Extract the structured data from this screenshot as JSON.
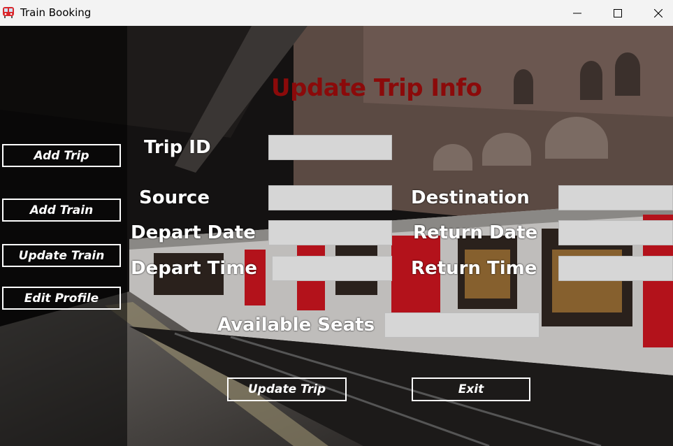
{
  "window": {
    "title": "Train Booking",
    "app_icon": "train-icon",
    "controls": [
      "minimize-icon",
      "maximize-icon",
      "close-icon"
    ]
  },
  "heading": "Update Trip Info",
  "colors": {
    "heading": "#8b0a0a",
    "field_bg": "#d6d6d6",
    "button_border": "#ffffff"
  },
  "sidebar": {
    "items": [
      {
        "label": "Add Trip"
      },
      {
        "label": "Add Train"
      },
      {
        "label": "Update Train"
      },
      {
        "label": "Edit Profile"
      }
    ]
  },
  "form": {
    "trip_id": {
      "label": "Trip ID",
      "value": ""
    },
    "source": {
      "label": "Source",
      "value": ""
    },
    "destination": {
      "label": "Destination",
      "value": ""
    },
    "depart_date": {
      "label": "Depart Date",
      "value": ""
    },
    "return_date": {
      "label": "Return Date",
      "value": ""
    },
    "depart_time": {
      "label": "Depart Time",
      "value": ""
    },
    "return_time": {
      "label": "Return Time",
      "value": ""
    },
    "available_seats": {
      "label": "Available Seats",
      "value": ""
    }
  },
  "actions": {
    "update_label": "Update Trip",
    "exit_label": "Exit"
  }
}
